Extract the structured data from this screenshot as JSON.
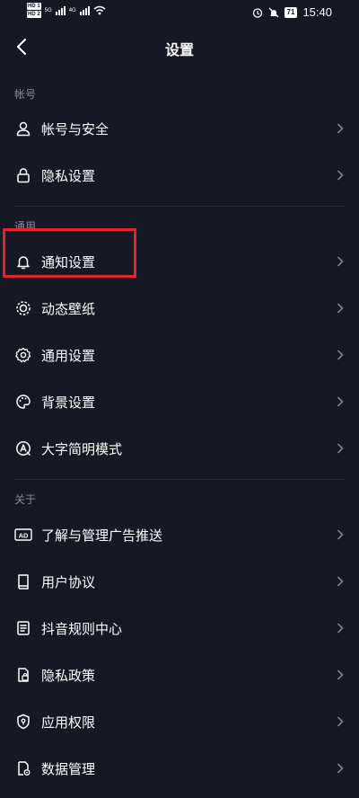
{
  "status_bar": {
    "hd1": "HD 1",
    "hd2": "HD 2",
    "net1": "5G",
    "net2": "4G",
    "battery": "71",
    "time": "15:40"
  },
  "header": {
    "title": "设置"
  },
  "sections": {
    "account": {
      "label": "帐号",
      "items": [
        {
          "label": "帐号与安全",
          "icon": "user-icon"
        },
        {
          "label": "隐私设置",
          "icon": "lock-icon"
        }
      ]
    },
    "general": {
      "label": "通用",
      "items": [
        {
          "label": "通知设置",
          "icon": "bell-icon"
        },
        {
          "label": "动态壁纸",
          "icon": "live-wallpaper-icon"
        },
        {
          "label": "通用设置",
          "icon": "gear-icon"
        },
        {
          "label": "背景设置",
          "icon": "palette-icon"
        },
        {
          "label": "大字简明模式",
          "icon": "large-font-icon"
        }
      ]
    },
    "about": {
      "label": "关于",
      "items": [
        {
          "label": "了解与管理广告推送",
          "icon": "ad-icon"
        },
        {
          "label": "用户协议",
          "icon": "book-icon"
        },
        {
          "label": "抖音规则中心",
          "icon": "rules-doc-icon"
        },
        {
          "label": "隐私政策",
          "icon": "privacy-doc-icon"
        },
        {
          "label": "应用权限",
          "icon": "shield-icon"
        },
        {
          "label": "数据管理",
          "icon": "data-file-icon"
        }
      ]
    }
  },
  "colors": {
    "background": "#161823",
    "highlight_border": "#e8202f",
    "section_label": "#8a8b91"
  }
}
